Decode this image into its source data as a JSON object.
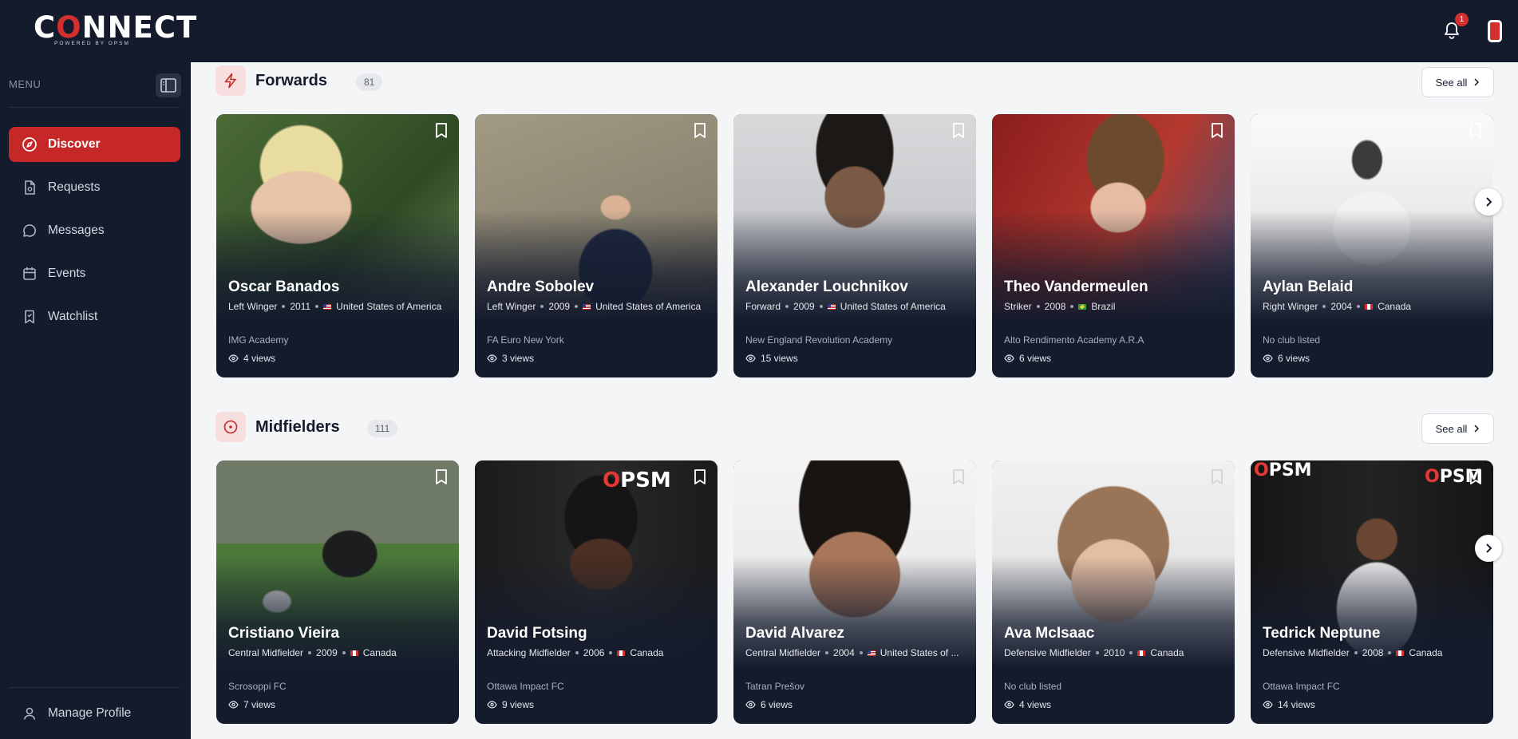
{
  "brand": {
    "logo_main": "CONNECT",
    "logo_tagline": "POWERED BY OPSM"
  },
  "header": {
    "notification_count": "1"
  },
  "sidebar": {
    "menu_label": "MENU",
    "items": [
      {
        "label": "Discover",
        "icon": "compass-icon",
        "active": true
      },
      {
        "label": "Requests",
        "icon": "document-icon",
        "active": false
      },
      {
        "label": "Messages",
        "icon": "chat-bubble-icon",
        "active": false
      },
      {
        "label": "Events",
        "icon": "calendar-icon",
        "active": false
      },
      {
        "label": "Watchlist",
        "icon": "bookmark-icon",
        "active": false
      }
    ],
    "manage_profile": "Manage Profile"
  },
  "sections": [
    {
      "title": "Forwards",
      "count": "81",
      "see_all": "See all",
      "icon": "lightning-icon",
      "players": [
        {
          "name": "Oscar Banados",
          "position": "Left Winger",
          "year": "2011",
          "country": "United States of America",
          "flag": "us",
          "club": "IMG Academy",
          "views": "4 views"
        },
        {
          "name": "Andre Sobolev",
          "position": "Left Winger",
          "year": "2009",
          "country": "United States of America",
          "flag": "us",
          "club": "FA Euro New York",
          "views": "3 views"
        },
        {
          "name": "Alexander Louchnikov",
          "position": "Forward",
          "year": "2009",
          "country": "United States of America",
          "flag": "us",
          "club": "New England Revolution Academy",
          "views": "15 views"
        },
        {
          "name": "Theo Vandermeulen",
          "position": "Striker",
          "year": "2008",
          "country": "Brazil",
          "flag": "br",
          "club": "Alto Rendimento Academy A.R.A",
          "views": "6 views"
        },
        {
          "name": "Aylan Belaid",
          "position": "Right Winger",
          "year": "2004",
          "country": "Canada",
          "flag": "ca",
          "club": "No club listed",
          "views": "6 views"
        }
      ]
    },
    {
      "title": "Midfielders",
      "count": "111",
      "see_all": "See all",
      "icon": "target-icon",
      "players": [
        {
          "name": "Cristiano Vieira",
          "position": "Central Midfielder",
          "year": "2009",
          "country": "Canada",
          "flag": "ca",
          "club": "Scrosoppi FC",
          "views": "7 views"
        },
        {
          "name": "David Fotsing",
          "position": "Attacking Midfielder",
          "year": "2006",
          "country": "Canada",
          "flag": "ca",
          "club": "Ottawa Impact FC",
          "views": "9 views"
        },
        {
          "name": "David Alvarez",
          "position": "Central Midfielder",
          "year": "2004",
          "country": "United States of ...",
          "flag": "us",
          "club": "Tatran Prešov",
          "views": "6 views"
        },
        {
          "name": "Ava McIsaac",
          "position": "Defensive Midfielder",
          "year": "2010",
          "country": "Canada",
          "flag": "ca",
          "club": "No club listed",
          "views": "4 views"
        },
        {
          "name": "Tedrick Neptune",
          "position": "Defensive Midfielder",
          "year": "2008",
          "country": "Canada",
          "flag": "ca",
          "club": "Ottawa Impact FC",
          "views": "14 views"
        }
      ]
    }
  ],
  "photo_overlays": {
    "opsm_text": "OPSM"
  },
  "colors": {
    "accent": "#c62828",
    "nav_bg": "#141b2d",
    "page_bg": "#f4f5f7"
  }
}
